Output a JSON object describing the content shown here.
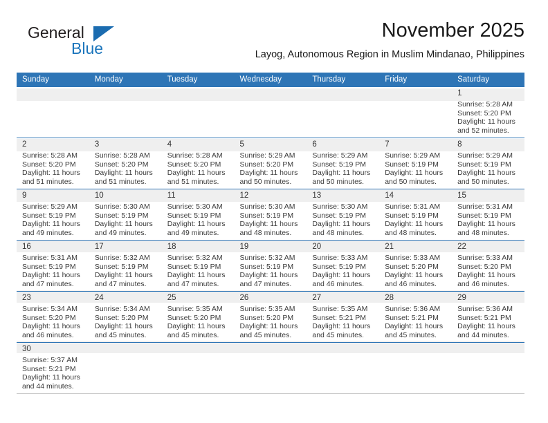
{
  "brand": {
    "name_part1": "General",
    "name_part2": "Blue",
    "flag_icon": "triangle-flag-icon"
  },
  "header": {
    "month_title": "November 2025",
    "location": "Layog, Autonomous Region in Muslim Mindanao, Philippines"
  },
  "colors": {
    "header_blue": "#2e75b6",
    "brand_blue": "#1b75bc",
    "day_band_gray": "#efefef",
    "row_separator": "#2e75b6"
  },
  "calendar": {
    "weekday_headers": [
      "Sunday",
      "Monday",
      "Tuesday",
      "Wednesday",
      "Thursday",
      "Friday",
      "Saturday"
    ],
    "weeks": [
      [
        {
          "day": "",
          "sunrise": "",
          "sunset": "",
          "daylight_line1": "",
          "daylight_line2": ""
        },
        {
          "day": "",
          "sunrise": "",
          "sunset": "",
          "daylight_line1": "",
          "daylight_line2": ""
        },
        {
          "day": "",
          "sunrise": "",
          "sunset": "",
          "daylight_line1": "",
          "daylight_line2": ""
        },
        {
          "day": "",
          "sunrise": "",
          "sunset": "",
          "daylight_line1": "",
          "daylight_line2": ""
        },
        {
          "day": "",
          "sunrise": "",
          "sunset": "",
          "daylight_line1": "",
          "daylight_line2": ""
        },
        {
          "day": "",
          "sunrise": "",
          "sunset": "",
          "daylight_line1": "",
          "daylight_line2": ""
        },
        {
          "day": "1",
          "sunrise": "Sunrise: 5:28 AM",
          "sunset": "Sunset: 5:20 PM",
          "daylight_line1": "Daylight: 11 hours",
          "daylight_line2": "and 52 minutes."
        }
      ],
      [
        {
          "day": "2",
          "sunrise": "Sunrise: 5:28 AM",
          "sunset": "Sunset: 5:20 PM",
          "daylight_line1": "Daylight: 11 hours",
          "daylight_line2": "and 51 minutes."
        },
        {
          "day": "3",
          "sunrise": "Sunrise: 5:28 AM",
          "sunset": "Sunset: 5:20 PM",
          "daylight_line1": "Daylight: 11 hours",
          "daylight_line2": "and 51 minutes."
        },
        {
          "day": "4",
          "sunrise": "Sunrise: 5:28 AM",
          "sunset": "Sunset: 5:20 PM",
          "daylight_line1": "Daylight: 11 hours",
          "daylight_line2": "and 51 minutes."
        },
        {
          "day": "5",
          "sunrise": "Sunrise: 5:29 AM",
          "sunset": "Sunset: 5:20 PM",
          "daylight_line1": "Daylight: 11 hours",
          "daylight_line2": "and 50 minutes."
        },
        {
          "day": "6",
          "sunrise": "Sunrise: 5:29 AM",
          "sunset": "Sunset: 5:19 PM",
          "daylight_line1": "Daylight: 11 hours",
          "daylight_line2": "and 50 minutes."
        },
        {
          "day": "7",
          "sunrise": "Sunrise: 5:29 AM",
          "sunset": "Sunset: 5:19 PM",
          "daylight_line1": "Daylight: 11 hours",
          "daylight_line2": "and 50 minutes."
        },
        {
          "day": "8",
          "sunrise": "Sunrise: 5:29 AM",
          "sunset": "Sunset: 5:19 PM",
          "daylight_line1": "Daylight: 11 hours",
          "daylight_line2": "and 50 minutes."
        }
      ],
      [
        {
          "day": "9",
          "sunrise": "Sunrise: 5:29 AM",
          "sunset": "Sunset: 5:19 PM",
          "daylight_line1": "Daylight: 11 hours",
          "daylight_line2": "and 49 minutes."
        },
        {
          "day": "10",
          "sunrise": "Sunrise: 5:30 AM",
          "sunset": "Sunset: 5:19 PM",
          "daylight_line1": "Daylight: 11 hours",
          "daylight_line2": "and 49 minutes."
        },
        {
          "day": "11",
          "sunrise": "Sunrise: 5:30 AM",
          "sunset": "Sunset: 5:19 PM",
          "daylight_line1": "Daylight: 11 hours",
          "daylight_line2": "and 49 minutes."
        },
        {
          "day": "12",
          "sunrise": "Sunrise: 5:30 AM",
          "sunset": "Sunset: 5:19 PM",
          "daylight_line1": "Daylight: 11 hours",
          "daylight_line2": "and 48 minutes."
        },
        {
          "day": "13",
          "sunrise": "Sunrise: 5:30 AM",
          "sunset": "Sunset: 5:19 PM",
          "daylight_line1": "Daylight: 11 hours",
          "daylight_line2": "and 48 minutes."
        },
        {
          "day": "14",
          "sunrise": "Sunrise: 5:31 AM",
          "sunset": "Sunset: 5:19 PM",
          "daylight_line1": "Daylight: 11 hours",
          "daylight_line2": "and 48 minutes."
        },
        {
          "day": "15",
          "sunrise": "Sunrise: 5:31 AM",
          "sunset": "Sunset: 5:19 PM",
          "daylight_line1": "Daylight: 11 hours",
          "daylight_line2": "and 48 minutes."
        }
      ],
      [
        {
          "day": "16",
          "sunrise": "Sunrise: 5:31 AM",
          "sunset": "Sunset: 5:19 PM",
          "daylight_line1": "Daylight: 11 hours",
          "daylight_line2": "and 47 minutes."
        },
        {
          "day": "17",
          "sunrise": "Sunrise: 5:32 AM",
          "sunset": "Sunset: 5:19 PM",
          "daylight_line1": "Daylight: 11 hours",
          "daylight_line2": "and 47 minutes."
        },
        {
          "day": "18",
          "sunrise": "Sunrise: 5:32 AM",
          "sunset": "Sunset: 5:19 PM",
          "daylight_line1": "Daylight: 11 hours",
          "daylight_line2": "and 47 minutes."
        },
        {
          "day": "19",
          "sunrise": "Sunrise: 5:32 AM",
          "sunset": "Sunset: 5:19 PM",
          "daylight_line1": "Daylight: 11 hours",
          "daylight_line2": "and 47 minutes."
        },
        {
          "day": "20",
          "sunrise": "Sunrise: 5:33 AM",
          "sunset": "Sunset: 5:19 PM",
          "daylight_line1": "Daylight: 11 hours",
          "daylight_line2": "and 46 minutes."
        },
        {
          "day": "21",
          "sunrise": "Sunrise: 5:33 AM",
          "sunset": "Sunset: 5:20 PM",
          "daylight_line1": "Daylight: 11 hours",
          "daylight_line2": "and 46 minutes."
        },
        {
          "day": "22",
          "sunrise": "Sunrise: 5:33 AM",
          "sunset": "Sunset: 5:20 PM",
          "daylight_line1": "Daylight: 11 hours",
          "daylight_line2": "and 46 minutes."
        }
      ],
      [
        {
          "day": "23",
          "sunrise": "Sunrise: 5:34 AM",
          "sunset": "Sunset: 5:20 PM",
          "daylight_line1": "Daylight: 11 hours",
          "daylight_line2": "and 46 minutes."
        },
        {
          "day": "24",
          "sunrise": "Sunrise: 5:34 AM",
          "sunset": "Sunset: 5:20 PM",
          "daylight_line1": "Daylight: 11 hours",
          "daylight_line2": "and 45 minutes."
        },
        {
          "day": "25",
          "sunrise": "Sunrise: 5:35 AM",
          "sunset": "Sunset: 5:20 PM",
          "daylight_line1": "Daylight: 11 hours",
          "daylight_line2": "and 45 minutes."
        },
        {
          "day": "26",
          "sunrise": "Sunrise: 5:35 AM",
          "sunset": "Sunset: 5:20 PM",
          "daylight_line1": "Daylight: 11 hours",
          "daylight_line2": "and 45 minutes."
        },
        {
          "day": "27",
          "sunrise": "Sunrise: 5:35 AM",
          "sunset": "Sunset: 5:21 PM",
          "daylight_line1": "Daylight: 11 hours",
          "daylight_line2": "and 45 minutes."
        },
        {
          "day": "28",
          "sunrise": "Sunrise: 5:36 AM",
          "sunset": "Sunset: 5:21 PM",
          "daylight_line1": "Daylight: 11 hours",
          "daylight_line2": "and 45 minutes."
        },
        {
          "day": "29",
          "sunrise": "Sunrise: 5:36 AM",
          "sunset": "Sunset: 5:21 PM",
          "daylight_line1": "Daylight: 11 hours",
          "daylight_line2": "and 44 minutes."
        }
      ],
      [
        {
          "day": "30",
          "sunrise": "Sunrise: 5:37 AM",
          "sunset": "Sunset: 5:21 PM",
          "daylight_line1": "Daylight: 11 hours",
          "daylight_line2": "and 44 minutes."
        },
        {
          "day": "",
          "sunrise": "",
          "sunset": "",
          "daylight_line1": "",
          "daylight_line2": ""
        },
        {
          "day": "",
          "sunrise": "",
          "sunset": "",
          "daylight_line1": "",
          "daylight_line2": ""
        },
        {
          "day": "",
          "sunrise": "",
          "sunset": "",
          "daylight_line1": "",
          "daylight_line2": ""
        },
        {
          "day": "",
          "sunrise": "",
          "sunset": "",
          "daylight_line1": "",
          "daylight_line2": ""
        },
        {
          "day": "",
          "sunrise": "",
          "sunset": "",
          "daylight_line1": "",
          "daylight_line2": ""
        },
        {
          "day": "",
          "sunrise": "",
          "sunset": "",
          "daylight_line1": "",
          "daylight_line2": ""
        }
      ]
    ]
  }
}
